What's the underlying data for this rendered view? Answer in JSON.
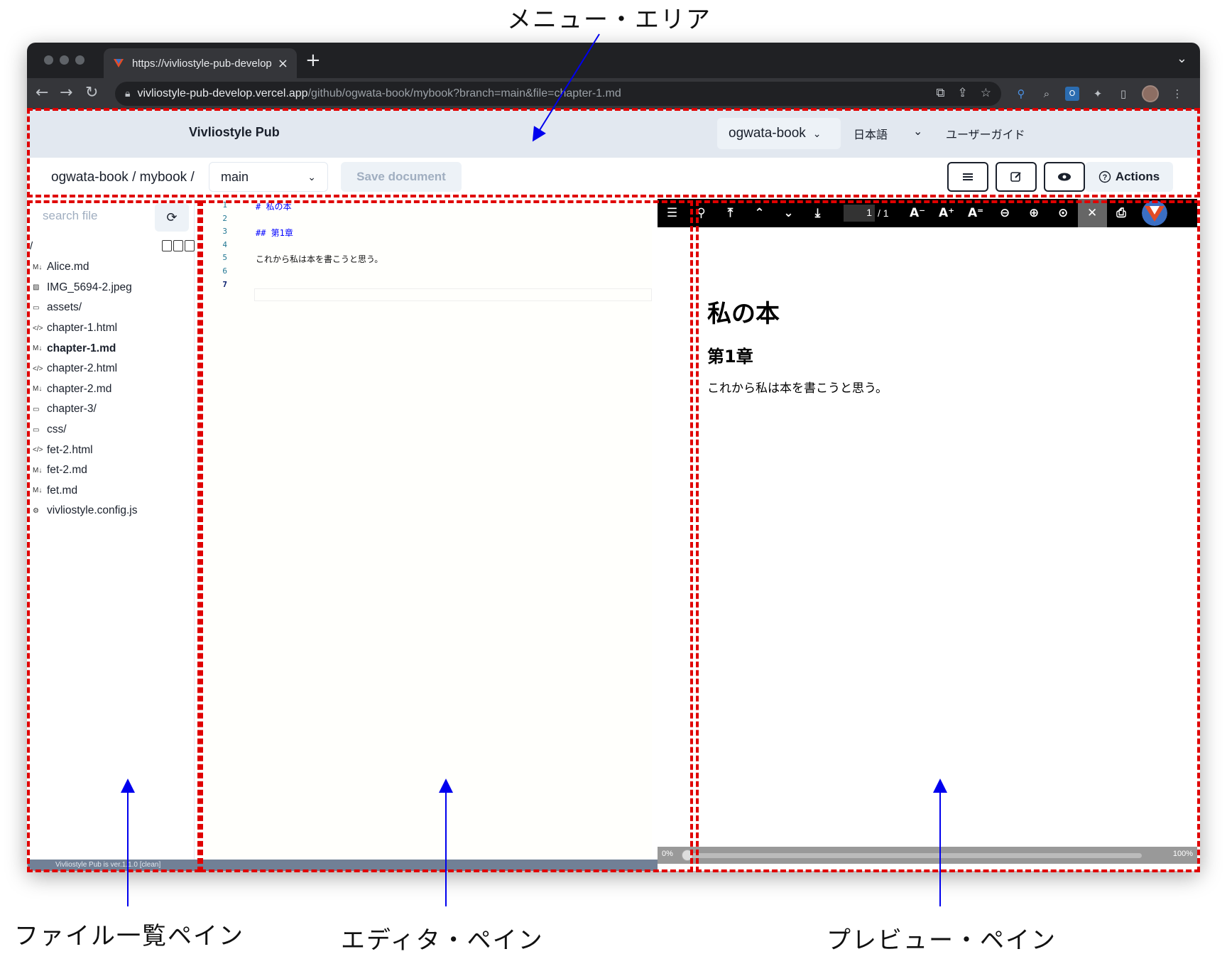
{
  "annotations": {
    "menu_area": "メニュー・エリア",
    "file_pane": "ファイル一覧ペイン",
    "editor_pane": "エディタ・ペイン",
    "preview_pane": "プレビュー・ペイン"
  },
  "browser": {
    "tab_title": "https://vivliostyle-pub-develop",
    "url_host": "vivliostyle-pub-develop.vercel.app",
    "url_path": "/github/ogwata-book/mybook?branch=main&file=chapter-1.md"
  },
  "app": {
    "brand": "Vivliostyle Pub",
    "project_button": "ogwata-book",
    "language": "日本語",
    "user_guide": "ユーザーガイド",
    "breadcrumb": "ogwata-book / mybook /",
    "branch": "main",
    "save_button": "Save document",
    "actions_button": "Actions",
    "footer": "Vivliostyle Pub is ver.1.1.0 [clean]"
  },
  "file_pane": {
    "search_placeholder": "search file",
    "root": "/",
    "files": [
      {
        "icon": "markdown-icon",
        "label": "M↓",
        "name": "Alice.md",
        "active": false
      },
      {
        "icon": "image-file-icon",
        "label": "▨",
        "name": "IMG_5694-2.jpeg",
        "active": false
      },
      {
        "icon": "folder-icon",
        "label": "▭",
        "name": "assets/",
        "active": false
      },
      {
        "icon": "code-file-icon",
        "label": "</>",
        "name": "chapter-1.html",
        "active": false
      },
      {
        "icon": "markdown-icon",
        "label": "M↓",
        "name": "chapter-1.md",
        "active": true
      },
      {
        "icon": "code-file-icon",
        "label": "</>",
        "name": "chapter-2.html",
        "active": false
      },
      {
        "icon": "markdown-icon",
        "label": "M↓",
        "name": "chapter-2.md",
        "active": false
      },
      {
        "icon": "folder-icon",
        "label": "▭",
        "name": "chapter-3/",
        "active": false
      },
      {
        "icon": "folder-icon",
        "label": "▭",
        "name": "css/",
        "active": false
      },
      {
        "icon": "code-file-icon",
        "label": "</>",
        "name": "fet-2.html",
        "active": false
      },
      {
        "icon": "markdown-icon",
        "label": "M↓",
        "name": "fet-2.md",
        "active": false
      },
      {
        "icon": "markdown-icon",
        "label": "M↓",
        "name": "fet.md",
        "active": false
      },
      {
        "icon": "config-file-icon",
        "label": "⚙",
        "name": "vivliostyle.config.js",
        "active": false
      }
    ]
  },
  "editor": {
    "lines": [
      {
        "n": "1",
        "text": "# 私の本",
        "heading": true
      },
      {
        "n": "2",
        "text": "",
        "heading": false
      },
      {
        "n": "3",
        "text": "## 第1章",
        "heading": true
      },
      {
        "n": "4",
        "text": "",
        "heading": false
      },
      {
        "n": "5",
        "text": "これから私は本を書こうと思う。",
        "heading": false
      },
      {
        "n": "6",
        "text": "",
        "heading": false
      },
      {
        "n": "7",
        "text": "",
        "heading": false
      }
    ],
    "current_line": 7
  },
  "preview": {
    "page_current": "1",
    "page_total": "/ 1",
    "title": "私の本",
    "chapter": "第1章",
    "paragraph": "これから私は本を書こうと思う。",
    "progress_min": "0%",
    "progress_max": "100%",
    "progress_value": 0
  }
}
